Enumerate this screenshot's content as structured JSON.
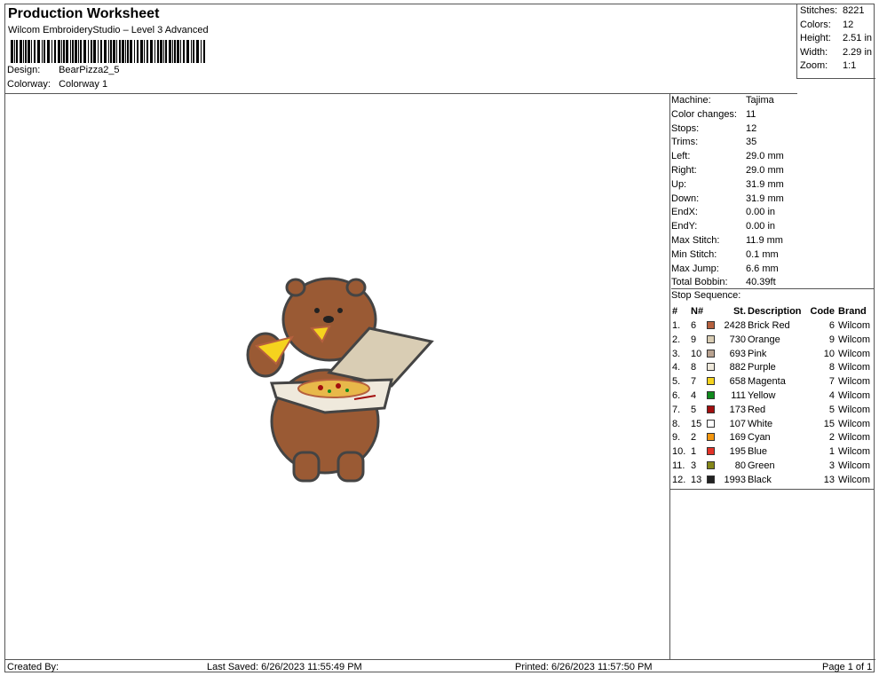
{
  "header": {
    "title": "Production Worksheet",
    "subtitle": "Wilcom EmbroideryStudio – Level 3 Advanced",
    "design_label": "Design:",
    "design_value": "BearPizza2_5",
    "colorway_label": "Colorway:",
    "colorway_value": "Colorway 1"
  },
  "summary": [
    {
      "k": "Stitches:",
      "v": "8221"
    },
    {
      "k": "Colors:",
      "v": "12"
    },
    {
      "k": "Height:",
      "v": "2.51 in"
    },
    {
      "k": "Width:",
      "v": "2.29 in"
    },
    {
      "k": "Zoom:",
      "v": "1:1"
    }
  ],
  "machine": [
    {
      "k": "Machine:",
      "v": "Tajima"
    },
    {
      "k": "Color changes:",
      "v": "11"
    },
    {
      "k": "Stops:",
      "v": "12"
    },
    {
      "k": "Trims:",
      "v": "35"
    },
    {
      "k": "Left:",
      "v": "29.0 mm"
    },
    {
      "k": "Right:",
      "v": "29.0 mm"
    },
    {
      "k": "Up:",
      "v": "31.9 mm"
    },
    {
      "k": "Down:",
      "v": "31.9 mm"
    },
    {
      "k": "EndX:",
      "v": "0.00 in"
    },
    {
      "k": "EndY:",
      "v": "0.00 in"
    },
    {
      "k": "Max Stitch:",
      "v": "11.9 mm"
    },
    {
      "k": "Min Stitch:",
      "v": "0.1 mm"
    },
    {
      "k": "Max Jump:",
      "v": "6.6 mm"
    },
    {
      "k": "Total Bobbin:",
      "v": "40.39ft"
    }
  ],
  "stop_sequence": {
    "title": "Stop Sequence:",
    "headers": {
      "idx": "#",
      "n": "N#",
      "st": "St.",
      "desc": "Description",
      "code": "Code",
      "brand": "Brand"
    },
    "rows": [
      {
        "idx": "1.",
        "n": "6",
        "color": "#b5603e",
        "st": "2428",
        "desc": "Brick Red",
        "code": "6",
        "brand": "Wilcom"
      },
      {
        "idx": "2.",
        "n": "9",
        "color": "#d9cdb4",
        "st": "730",
        "desc": "Orange",
        "code": "9",
        "brand": "Wilcom"
      },
      {
        "idx": "3.",
        "n": "10",
        "color": "#b8a290",
        "st": "693",
        "desc": "Pink",
        "code": "10",
        "brand": "Wilcom"
      },
      {
        "idx": "4.",
        "n": "8",
        "color": "#efe9dc",
        "st": "882",
        "desc": "Purple",
        "code": "8",
        "brand": "Wilcom"
      },
      {
        "idx": "5.",
        "n": "7",
        "color": "#f5d31e",
        "st": "658",
        "desc": "Magenta",
        "code": "7",
        "brand": "Wilcom"
      },
      {
        "idx": "6.",
        "n": "4",
        "color": "#0f8a1c",
        "st": "111",
        "desc": "Yellow",
        "code": "4",
        "brand": "Wilcom"
      },
      {
        "idx": "7.",
        "n": "5",
        "color": "#a20e0e",
        "st": "173",
        "desc": "Red",
        "code": "5",
        "brand": "Wilcom"
      },
      {
        "idx": "8.",
        "n": "15",
        "color": "#ffffff",
        "st": "107",
        "desc": "White",
        "code": "15",
        "brand": "Wilcom"
      },
      {
        "idx": "9.",
        "n": "2",
        "color": "#f4970f",
        "st": "169",
        "desc": "Cyan",
        "code": "2",
        "brand": "Wilcom"
      },
      {
        "idx": "10.",
        "n": "1",
        "color": "#e23227",
        "st": "195",
        "desc": "Blue",
        "code": "1",
        "brand": "Wilcom"
      },
      {
        "idx": "11.",
        "n": "3",
        "color": "#848719",
        "st": "80",
        "desc": "Green",
        "code": "3",
        "brand": "Wilcom"
      },
      {
        "idx": "12.",
        "n": "13",
        "color": "#222222",
        "st": "1993",
        "desc": "Black",
        "code": "13",
        "brand": "Wilcom"
      }
    ]
  },
  "footer": {
    "created": "Created By:",
    "saved": "Last Saved: 6/26/2023 11:55:49 PM",
    "printed": "Printed: 6/26/2023 11:57:50 PM",
    "page": "Page 1 of 1"
  }
}
